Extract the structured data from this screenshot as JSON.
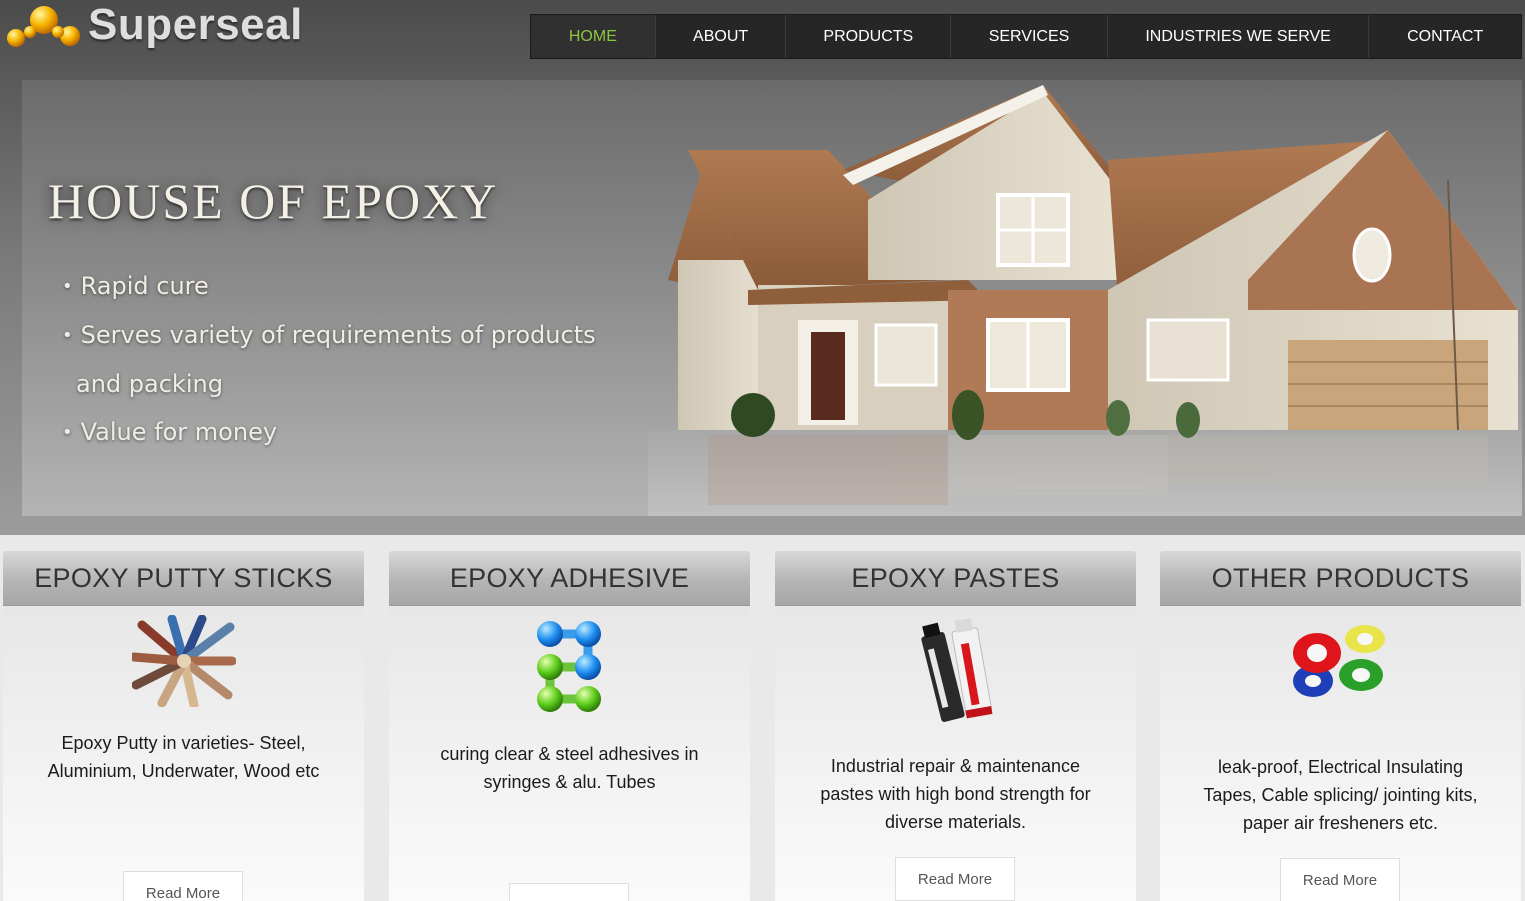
{
  "logo": {
    "text": "Superseal",
    "icon": "molecule-dots-logo-icon"
  },
  "nav": {
    "items": [
      "HOME",
      "ABOUT",
      "PRODUCTS",
      "SERVICES",
      "INDUSTRIES WE SERVE",
      "CONTACT"
    ],
    "active": "HOME",
    "colors": {
      "bar": "#262626",
      "active": "#8cc63f",
      "text": "#ffffff"
    }
  },
  "hero": {
    "title": "HOUSE OF EPOXY",
    "bullets": [
      "Rapid cure",
      "Serves variety of requirements of products",
      "and packing",
      "Value for money"
    ],
    "image": "house-photo"
  },
  "cards": [
    {
      "title": "EPOXY PUTTY STICKS",
      "text": "Epoxy Putty in varieties- Steel, Aluminium, Underwater, Wood etc",
      "button": "Read More",
      "icon": "putty-sticks-icon"
    },
    {
      "title": "EPOXY ADHESIVE",
      "text": "curing clear & steel adhesives in syringes & alu. Tubes",
      "button": "",
      "icon": "molecule-icon"
    },
    {
      "title": "EPOXY PASTES",
      "text": "Industrial repair & maintenance pastes with high bond strength for diverse materials.",
      "button": "Read More",
      "icon": "paste-tubes-icon"
    },
    {
      "title": "OTHER PRODUCTS",
      "text": "leak-proof, Electrical Insulating Tapes, Cable splicing/ jointing kits, paper air fresheners etc.",
      "button": "Read More",
      "icon": "tape-rolls-icon"
    }
  ]
}
